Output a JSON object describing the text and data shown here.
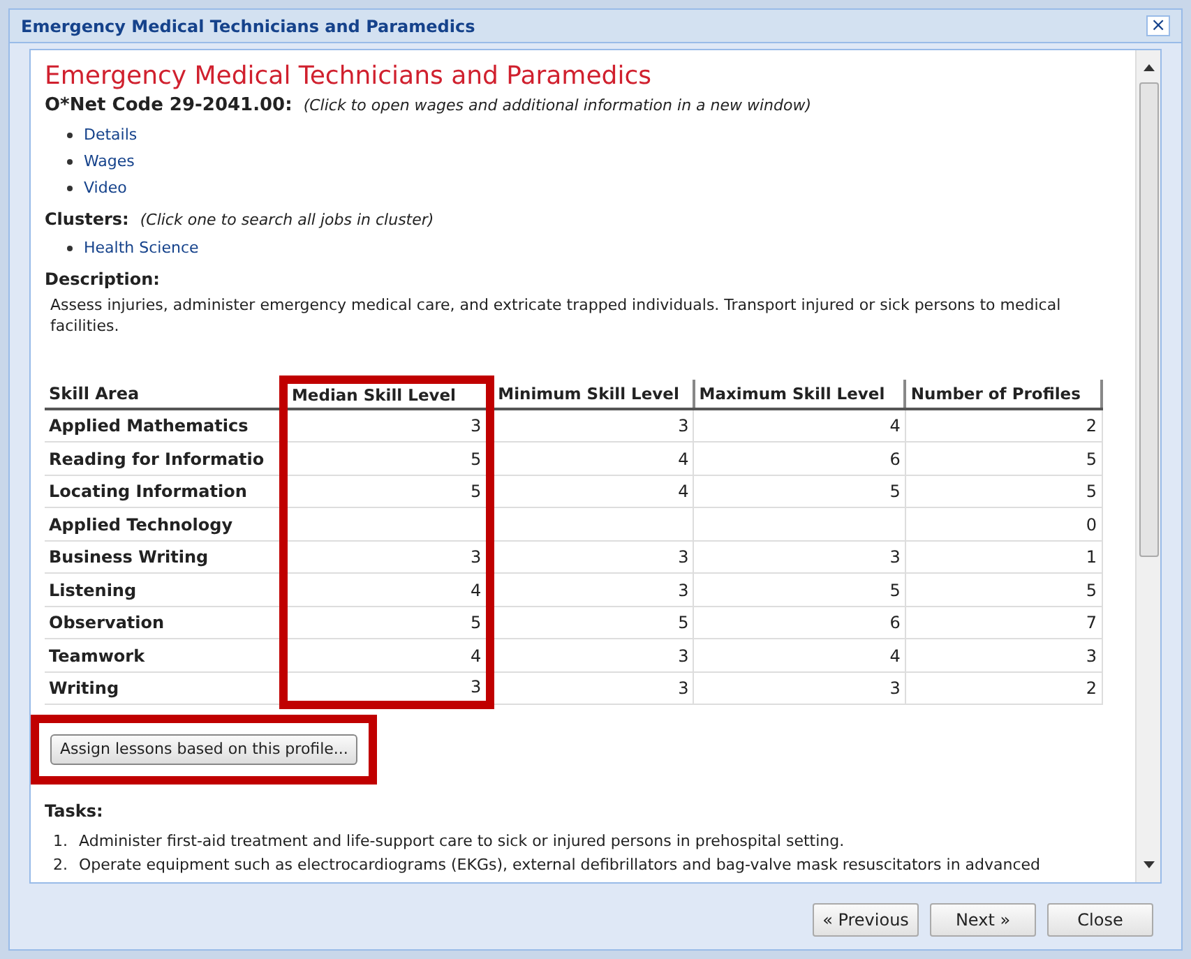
{
  "window": {
    "title": "Emergency Medical Technicians and Paramedics",
    "close": "×"
  },
  "heading": "Emergency Medical Technicians and Paramedics",
  "code": {
    "label": "O*Net Code 29-2041.00:",
    "hint": "(Click to open wages and additional information in a new window)"
  },
  "links": [
    "Details",
    "Wages",
    "Video"
  ],
  "clusters": {
    "label": "Clusters:",
    "hint": "(Click one to search all jobs in cluster)",
    "items": [
      "Health Science"
    ]
  },
  "description": {
    "label": "Description:",
    "text": "Assess injuries, administer emergency medical care, and extricate trapped individuals. Transport injured or sick persons to medical facilities."
  },
  "table": {
    "columns": [
      {
        "label": "Skill Area",
        "highlighted": false
      },
      {
        "label": "Median Skill Level",
        "highlighted": true
      },
      {
        "label": "Minimum Skill Level",
        "highlighted": false
      },
      {
        "label": "Maximum Skill Level",
        "highlighted": false
      },
      {
        "label": "Number of Profiles",
        "highlighted": false
      }
    ],
    "rows": [
      [
        "Applied Mathematics",
        "3",
        "3",
        "4",
        "2"
      ],
      [
        "Reading for Informatio",
        "5",
        "4",
        "6",
        "5"
      ],
      [
        "Locating Information",
        "5",
        "4",
        "5",
        "5"
      ],
      [
        "Applied Technology",
        "",
        "",
        "",
        "0"
      ],
      [
        "Business Writing",
        "3",
        "3",
        "3",
        "1"
      ],
      [
        "Listening",
        "4",
        "3",
        "5",
        "5"
      ],
      [
        "Observation",
        "5",
        "5",
        "6",
        "7"
      ],
      [
        "Teamwork",
        "4",
        "3",
        "4",
        "3"
      ],
      [
        "Writing",
        "3",
        "3",
        "3",
        "2"
      ]
    ]
  },
  "assign_button": {
    "label": "Assign lessons based on this profile...",
    "highlighted": true
  },
  "tasks": {
    "label": "Tasks:",
    "items": [
      {
        "number": "1.",
        "text": "Administer first-aid treatment and life-support care to sick or injured persons in prehospital setting."
      },
      {
        "number": "2.",
        "text": "Operate equipment such as electrocardiograms (EKGs), external defibrillators and bag-valve mask resuscitators in advanced"
      }
    ]
  },
  "footer_buttons": [
    "« Previous",
    "Next »",
    "Close"
  ]
}
